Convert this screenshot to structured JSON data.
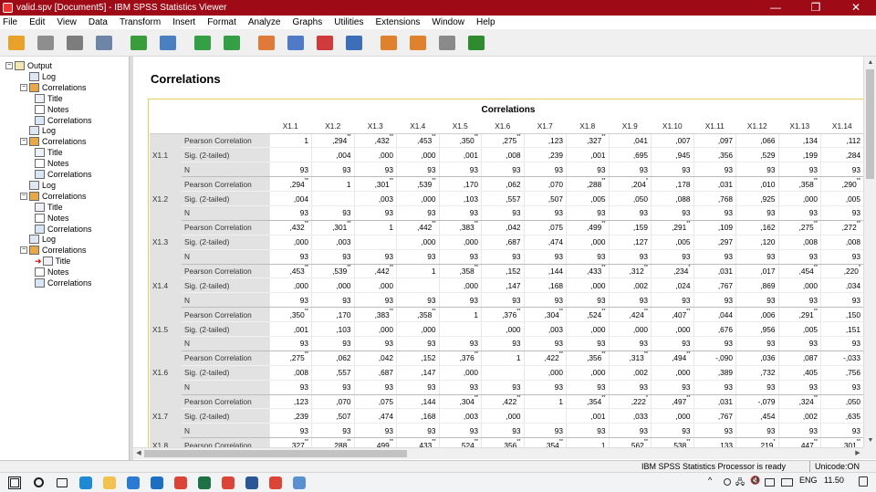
{
  "window": {
    "title": "valid.spv [Document5] - IBM SPSS Statistics Viewer",
    "minimize": "—",
    "maximize": "❐",
    "close": "✕"
  },
  "menu": [
    "File",
    "Edit",
    "View",
    "Data",
    "Transform",
    "Insert",
    "Format",
    "Analyze",
    "Graphs",
    "Utilities",
    "Extensions",
    "Window",
    "Help"
  ],
  "toolbar_icons": [
    {
      "name": "open-icon",
      "color": "#e8a22a"
    },
    {
      "name": "save-icon",
      "color": "#8e8e8e"
    },
    {
      "name": "print-icon",
      "color": "#7d7d7d"
    },
    {
      "name": "print-preview-icon",
      "color": "#6d86a8"
    },
    {
      "name": "export-icon",
      "color": "#3a9c3a"
    },
    {
      "name": "recall-dialog-icon",
      "color": "#4a7fc2"
    },
    {
      "name": "undo-icon",
      "color": "#34a045"
    },
    {
      "name": "redo-icon",
      "color": "#34a045"
    },
    {
      "name": "goto-data-icon",
      "color": "#e07a3a"
    },
    {
      "name": "goto-case-icon",
      "color": "#4f7ac8"
    },
    {
      "name": "insert-variable-icon",
      "color": "#d03a3a"
    },
    {
      "name": "variables-icon",
      "color": "#3d6fb8"
    },
    {
      "name": "designate-window-icon",
      "color": "#e0822d"
    },
    {
      "name": "output-window-icon",
      "color": "#e0822d"
    },
    {
      "name": "show-all-icon",
      "color": "#8a8a8a"
    },
    {
      "name": "add-item-icon",
      "color": "#2e8b2e"
    }
  ],
  "outline": [
    {
      "level": 0,
      "label": "Output",
      "icon": "out",
      "expander": "−"
    },
    {
      "level": 1,
      "label": "Log",
      "icon": "log"
    },
    {
      "level": 1,
      "label": "Correlations",
      "icon": "cor",
      "expander": "−"
    },
    {
      "level": 2,
      "label": "Title",
      "icon": "tit"
    },
    {
      "level": 2,
      "label": "Notes",
      "icon": "not"
    },
    {
      "level": 2,
      "label": "Correlations",
      "icon": "tab"
    },
    {
      "level": 1,
      "label": "Log",
      "icon": "log"
    },
    {
      "level": 1,
      "label": "Correlations",
      "icon": "cor",
      "expander": "−"
    },
    {
      "level": 2,
      "label": "Title",
      "icon": "tit"
    },
    {
      "level": 2,
      "label": "Notes",
      "icon": "not"
    },
    {
      "level": 2,
      "label": "Correlations",
      "icon": "tab"
    },
    {
      "level": 1,
      "label": "Log",
      "icon": "log"
    },
    {
      "level": 1,
      "label": "Correlations",
      "icon": "cor",
      "expander": "−"
    },
    {
      "level": 2,
      "label": "Title",
      "icon": "tit"
    },
    {
      "level": 2,
      "label": "Notes",
      "icon": "not"
    },
    {
      "level": 2,
      "label": "Correlations",
      "icon": "tab"
    },
    {
      "level": 1,
      "label": "Log",
      "icon": "log"
    },
    {
      "level": 1,
      "label": "Correlations",
      "icon": "cor",
      "expander": "−"
    },
    {
      "level": 2,
      "label": "Title",
      "icon": "tit",
      "selected": true
    },
    {
      "level": 2,
      "label": "Notes",
      "icon": "not"
    },
    {
      "level": 2,
      "label": "Correlations",
      "icon": "tab"
    }
  ],
  "output": {
    "heading": "Correlations",
    "table_title": "Correlations",
    "columns": [
      "X1.1",
      "X1.2",
      "X1.3",
      "X1.4",
      "X1.5",
      "X1.6",
      "X1.7",
      "X1.8",
      "X1.9",
      "X1.10",
      "X1.11",
      "X1.12",
      "X1.13",
      "X1.14"
    ],
    "stat_labels": [
      "Pearson Correlation",
      "Sig. (2-tailed)",
      "N"
    ],
    "rows": [
      {
        "var": "X1.1",
        "pearson": [
          "1",
          ",294**",
          ",432**",
          ",453**",
          ",350**",
          ",275**",
          ",123",
          ",327**",
          ",041",
          ",007",
          ",097",
          ",066",
          ",134",
          ",112"
        ],
        "sig": [
          "",
          ",004",
          ",000",
          ",000",
          ",001",
          ",008",
          ",239",
          ",001",
          ",695",
          ",945",
          ",356",
          ",529",
          ",199",
          ",284"
        ],
        "n": [
          "93",
          "93",
          "93",
          "93",
          "93",
          "93",
          "93",
          "93",
          "93",
          "93",
          "93",
          "93",
          "93",
          "93"
        ]
      },
      {
        "var": "X1.2",
        "pearson": [
          ",294**",
          "1",
          ",301**",
          ",539**",
          ",170",
          ",062",
          ",070",
          ",288**",
          ",204*",
          ",178",
          ",031",
          ",010",
          ",358**",
          ",290**"
        ],
        "sig": [
          ",004",
          "",
          ",003",
          ",000",
          ",103",
          ",557",
          ",507",
          ",005",
          ",050",
          ",088",
          ",768",
          ",925",
          ",000",
          ",005"
        ],
        "n": [
          "93",
          "93",
          "93",
          "93",
          "93",
          "93",
          "93",
          "93",
          "93",
          "93",
          "93",
          "93",
          "93",
          "93"
        ]
      },
      {
        "var": "X1.3",
        "pearson": [
          ",432**",
          ",301**",
          "1",
          ",442**",
          ",383**",
          ",042",
          ",075",
          ",499**",
          ",159",
          ",291**",
          ",109",
          ",162",
          ",275**",
          ",272**"
        ],
        "sig": [
          ",000",
          ",003",
          "",
          ",000",
          ",000",
          ",687",
          ",474",
          ",000",
          ",127",
          ",005",
          ",297",
          ",120",
          ",008",
          ",008"
        ],
        "n": [
          "93",
          "93",
          "93",
          "93",
          "93",
          "93",
          "93",
          "93",
          "93",
          "93",
          "93",
          "93",
          "93",
          "93"
        ]
      },
      {
        "var": "X1.4",
        "pearson": [
          ",453**",
          ",539**",
          ",442**",
          "1",
          ",358**",
          ",152",
          ",144",
          ",433**",
          ",312**",
          ",234*",
          ",031",
          ",017",
          ",454**",
          ",220*"
        ],
        "sig": [
          ",000",
          ",000",
          ",000",
          "",
          ",000",
          ",147",
          ",168",
          ",000",
          ",002",
          ",024",
          ",767",
          ",869",
          ",000",
          ",034"
        ],
        "n": [
          "93",
          "93",
          "93",
          "93",
          "93",
          "93",
          "93",
          "93",
          "93",
          "93",
          "93",
          "93",
          "93",
          "93"
        ]
      },
      {
        "var": "X1.5",
        "pearson": [
          ",350**",
          ",170",
          ",383**",
          ",358**",
          "1",
          ",376**",
          ",304**",
          ",524**",
          ",424**",
          ",407**",
          ",044",
          ",006",
          ",291**",
          ",150"
        ],
        "sig": [
          ",001",
          ",103",
          ",000",
          ",000",
          "",
          ",000",
          ",003",
          ",000",
          ",000",
          ",000",
          ",676",
          ",956",
          ",005",
          ",151"
        ],
        "n": [
          "93",
          "93",
          "93",
          "93",
          "93",
          "93",
          "93",
          "93",
          "93",
          "93",
          "93",
          "93",
          "93",
          "93"
        ]
      },
      {
        "var": "X1.6",
        "pearson": [
          ",275**",
          ",062",
          ",042",
          ",152",
          ",376**",
          "1",
          ",422**",
          ",356**",
          ",313**",
          ",494**",
          "-,090",
          ",036",
          ",087",
          "-,033"
        ],
        "sig": [
          ",008",
          ",557",
          ",687",
          ",147",
          ",000",
          "",
          ",000",
          ",000",
          ",002",
          ",000",
          ",389",
          ",732",
          ",405",
          ",756"
        ],
        "n": [
          "93",
          "93",
          "93",
          "93",
          "93",
          "93",
          "93",
          "93",
          "93",
          "93",
          "93",
          "93",
          "93",
          "93"
        ]
      },
      {
        "var": "X1.7",
        "pearson": [
          ",123",
          ",070",
          ",075",
          ",144",
          ",304**",
          ",422**",
          "1",
          ",354**",
          ",222*",
          ",497**",
          ",031",
          "-,079",
          ",324**",
          ",050"
        ],
        "sig": [
          ",239",
          ",507",
          ",474",
          ",168",
          ",003",
          ",000",
          "",
          ",001",
          ",033",
          ",000",
          ",767",
          ",454",
          ",002",
          ",635"
        ],
        "n": [
          "93",
          "93",
          "93",
          "93",
          "93",
          "93",
          "93",
          "93",
          "93",
          "93",
          "93",
          "93",
          "93",
          "93"
        ]
      },
      {
        "var": "X1.8",
        "pearson": [
          ",327**",
          ",288**",
          ",499**",
          ",433**",
          ",524**",
          ",356**",
          ",354**",
          "1",
          ",562**",
          ",538**",
          ",133",
          ",219*",
          ",447**",
          ",301**"
        ],
        "sig": [],
        "n": []
      }
    ]
  },
  "status": {
    "processor": "IBM SPSS Statistics Processor is ready",
    "encoding": "Unicode:ON"
  },
  "taskbar": {
    "apps": [
      {
        "name": "start-icon",
        "color": "#1e1e1e"
      },
      {
        "name": "search-icon",
        "color": "#1e1e1e"
      },
      {
        "name": "task-view-icon",
        "color": "#1e1e1e"
      },
      {
        "name": "edge-icon",
        "color": "#1f8ad4"
      },
      {
        "name": "file-explorer-icon",
        "color": "#f2c14e"
      },
      {
        "name": "store-icon",
        "color": "#2b7bd5"
      },
      {
        "name": "mail-icon",
        "color": "#1d6fc4"
      },
      {
        "name": "chrome-icon",
        "color": "#db4437"
      },
      {
        "name": "excel-icon",
        "color": "#1e7145"
      },
      {
        "name": "chrome-icon",
        "color": "#db4437"
      },
      {
        "name": "word-icon",
        "color": "#2b5797"
      },
      {
        "name": "chrome-icon",
        "color": "#db4437"
      },
      {
        "name": "spss-icon",
        "color": "#5a8fd0"
      }
    ],
    "chevron": "^",
    "language": "ENG",
    "time": "11.50"
  }
}
